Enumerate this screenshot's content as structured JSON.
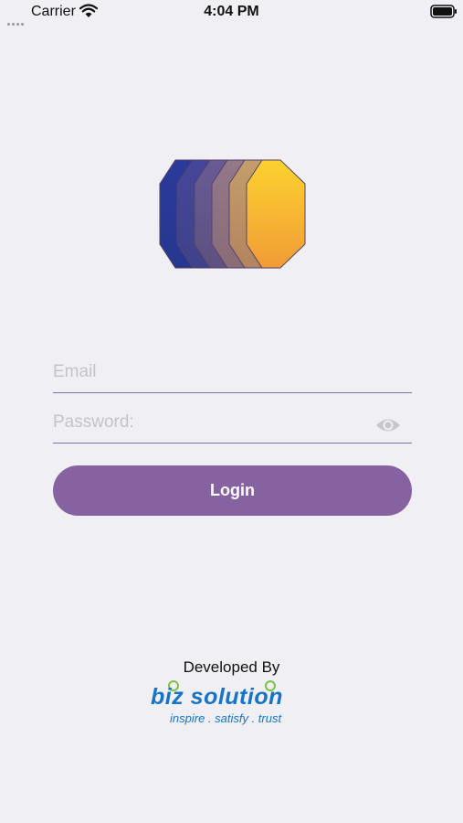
{
  "status_bar": {
    "carrier": "Carrier",
    "time": "4:04 PM"
  },
  "login": {
    "email_placeholder": "Email",
    "password_placeholder": "Password:",
    "button_label": "Login"
  },
  "footer": {
    "developed_by": "Developed By",
    "brand_name": "biz solution",
    "brand_tagline": "inspire . satisfy . trust"
  },
  "colors": {
    "background": "#efeff4",
    "accent": "#8762a0",
    "brand_blue": "#1673c8",
    "brand_green": "#7cc242",
    "logo_gradient_start": "#2a3f9c",
    "logo_gradient_end": "#f7a530"
  },
  "icons": {
    "wifi": "wifi-icon",
    "battery": "battery-icon",
    "eye": "eye-icon",
    "logo": "hexagon-logo"
  }
}
